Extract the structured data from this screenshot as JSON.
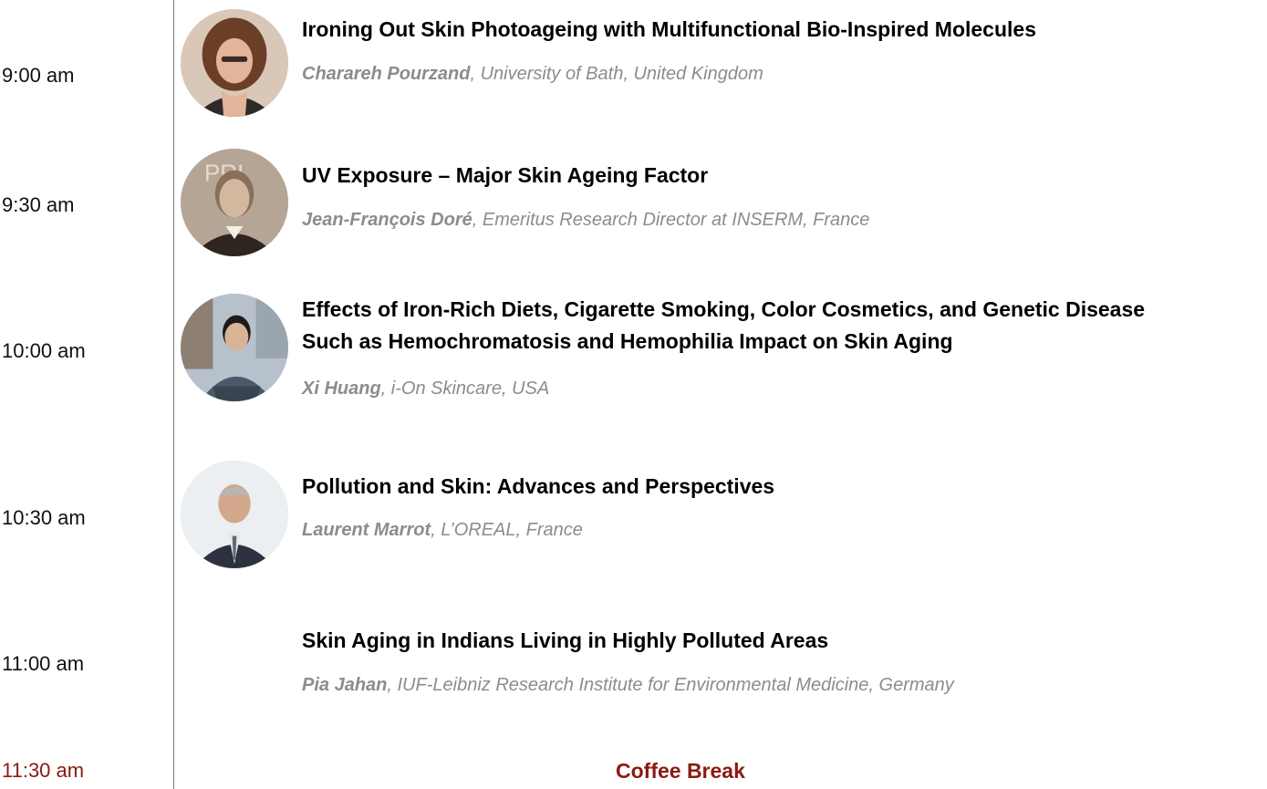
{
  "sessions": [
    {
      "time": "9:00 am",
      "title": "Ironing Out Skin Photoageing with Multifunctional Bio-Inspired Molecules",
      "speaker_name": "Charareh Pourzand",
      "affiliation": ", University of Bath, United Kingdom"
    },
    {
      "time": "9:30 am",
      "title": "UV Exposure – Major Skin Ageing Factor",
      "speaker_name": "Jean-François Doré",
      "affiliation": ", Emeritus Research Director at INSERM, France"
    },
    {
      "time": "10:00 am",
      "title_line1": "Effects of Iron-Rich Diets, Cigarette Smoking, Color Cosmetics, and Genetic Disease",
      "title_line2": "Such as Hemochromatosis and Hemophilia Impact on Skin Aging",
      "speaker_name": "Xi Huang",
      "affiliation": ", i-On Skincare, USA"
    },
    {
      "time": "10:30 am",
      "title": "Pollution and Skin: Advances and Perspectives",
      "speaker_name": "Laurent Marrot",
      "affiliation": ", L’OREAL, France"
    },
    {
      "time": "11:00 am",
      "title": "Skin Aging in Indians Living in Highly Polluted Areas",
      "speaker_name": "Pia Jahan",
      "affiliation": ", IUF-Leibniz Research Institute for Environmental Medicine, Germany"
    }
  ],
  "coffee_break": {
    "time": "11:30 am",
    "label": "Coffee Break"
  },
  "colors": {
    "break_accent": "#8b1a10",
    "speaker_gray": "#8c8c8c",
    "timeline": "#7a7a7a"
  }
}
